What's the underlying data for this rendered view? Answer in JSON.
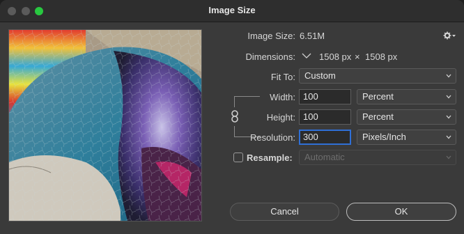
{
  "window": {
    "title": "Image Size"
  },
  "info": {
    "image_size_label": "Image Size:",
    "image_size_value": "6.51M",
    "dimensions_label": "Dimensions:",
    "dimensions_width": "1508 px",
    "dimensions_x": "×",
    "dimensions_height": "1508 px"
  },
  "fit_to": {
    "label": "Fit To:",
    "value": "Custom"
  },
  "width": {
    "label": "Width:",
    "value": "100",
    "unit": "Percent"
  },
  "height": {
    "label": "Height:",
    "value": "100",
    "unit": "Percent"
  },
  "resolution": {
    "label": "Resolution:",
    "value": "300",
    "unit": "Pixels/Inch"
  },
  "resample": {
    "label": "Resample:",
    "value": "Automatic",
    "checked": false
  },
  "buttons": {
    "cancel": "Cancel",
    "ok": "OK"
  },
  "icons": {
    "gear": "gear-icon",
    "chain": "chain-link-icon",
    "dimensions_menu": "chevron-down-icon"
  },
  "colors": {
    "accent": "#2f6fd6",
    "window_bg": "#3a3a3a",
    "traffic_green": "#28c840"
  }
}
